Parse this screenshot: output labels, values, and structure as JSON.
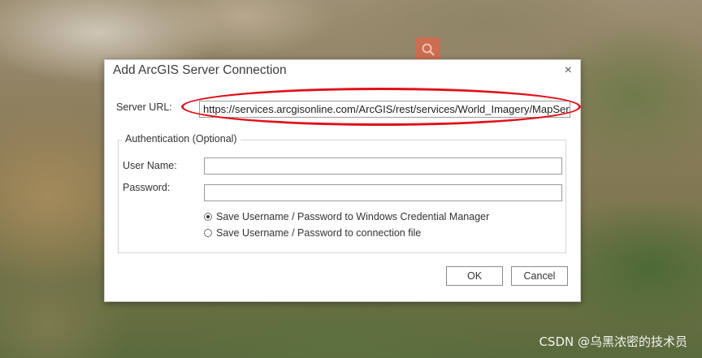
{
  "dialog": {
    "title": "Add ArcGIS Server Connection",
    "close_glyph": "×",
    "server_url_label": "Server URL:",
    "server_url_value": "https://services.arcgisonline.com/ArcGIS/rest/services/World_Imagery/MapServer",
    "auth_group_title": "Authentication (Optional)",
    "username_label": "User Name:",
    "username_value": "",
    "password_label": "Password:",
    "password_value": "",
    "radio_options": [
      {
        "label": "Save Username / Password to Windows Credential Manager",
        "checked": true
      },
      {
        "label": "Save Username / Password to connection file",
        "checked": false
      }
    ],
    "ok_label": "OK",
    "cancel_label": "Cancel"
  },
  "map": {
    "search_icon": "search-icon",
    "search_button_color": "#d6684e"
  },
  "annotation": {
    "color": "#e0101a"
  },
  "watermark": "CSDN @乌黑浓密的技术员"
}
